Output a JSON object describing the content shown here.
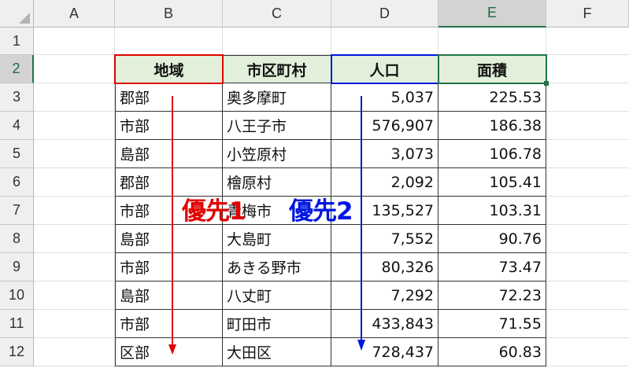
{
  "columns": [
    "A",
    "B",
    "C",
    "D",
    "E",
    "F"
  ],
  "rows": [
    "1",
    "2",
    "3",
    "4",
    "5",
    "6",
    "7",
    "8",
    "9",
    "10",
    "11",
    "12"
  ],
  "table": {
    "headers": [
      "地域",
      "市区町村",
      "人口",
      "面積"
    ],
    "data": [
      [
        "郡部",
        "奥多摩町",
        "5,037",
        "225.53"
      ],
      [
        "市部",
        "八王子市",
        "576,907",
        "186.38"
      ],
      [
        "島部",
        "小笠原村",
        "3,073",
        "106.78"
      ],
      [
        "郡部",
        "檜原村",
        "2,092",
        "105.41"
      ],
      [
        "市部",
        "青梅市",
        "135,527",
        "103.31"
      ],
      [
        "島部",
        "大島町",
        "7,552",
        "90.76"
      ],
      [
        "市部",
        "あきる野市",
        "80,326",
        "73.47"
      ],
      [
        "島部",
        "八丈町",
        "7,292",
        "72.23"
      ],
      [
        "市部",
        "町田市",
        "433,843",
        "71.55"
      ],
      [
        "区部",
        "大田区",
        "728,437",
        "60.83"
      ]
    ]
  },
  "annotations": {
    "priority1": {
      "label": "優先1",
      "color": "#e00000"
    },
    "priority2": {
      "label": "優先2",
      "color": "#0016e0"
    }
  },
  "selection": {
    "active_column": "E",
    "active_row": "2"
  },
  "colors": {
    "header_fill": "#e2efda",
    "selection": "#217346"
  }
}
